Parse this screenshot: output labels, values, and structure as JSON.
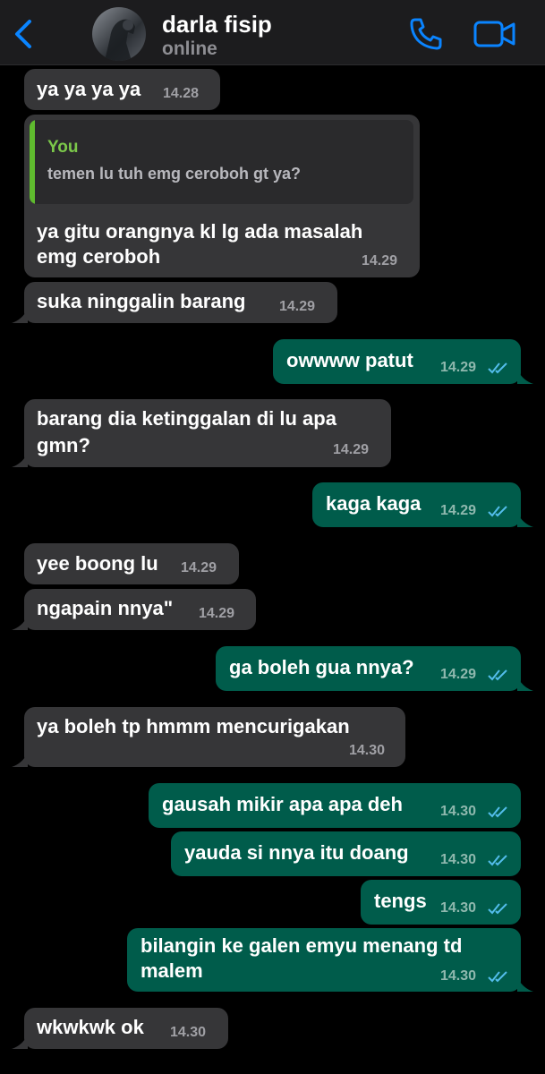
{
  "header": {
    "contact_name": "darla fisip",
    "status": "online",
    "icons": [
      "back-chevron-icon",
      "avatar",
      "phone-icon",
      "video-camera-icon"
    ],
    "accent_color": "#0a84ff"
  },
  "colors": {
    "incoming_bubble": "#363638",
    "outgoing_bubble": "#005c4b",
    "read_ticks": "#53bdeb",
    "quote_bar": "#5fbb2e"
  },
  "messages": [
    {
      "dir": "in",
      "text": "ya ya ya ya",
      "time": "14.28"
    },
    {
      "dir": "in",
      "quote_author": "You",
      "quote_text": "temen lu tuh emg ceroboh gt ya?",
      "line1": "ya gitu orangnya kl lg ada masalah",
      "line2": "emg ceroboh",
      "time": "14.29"
    },
    {
      "dir": "in",
      "text": "suka ninggalin barang",
      "time": "14.29"
    },
    {
      "dir": "out",
      "text": "owwww patut",
      "time": "14.29"
    },
    {
      "dir": "in",
      "line1": "barang dia ketinggalan di lu apa",
      "line2": "gmn?",
      "time": "14.29"
    },
    {
      "dir": "out",
      "text": "kaga kaga",
      "time": "14.29"
    },
    {
      "dir": "in",
      "text": "yee boong lu",
      "time": "14.29"
    },
    {
      "dir": "in",
      "text": "ngapain nnya\"",
      "time": "14.29"
    },
    {
      "dir": "out",
      "text": "ga boleh gua nnya?",
      "time": "14.29"
    },
    {
      "dir": "in",
      "text": "ya boleh tp hmmm mencurigakan",
      "time": "14.30"
    },
    {
      "dir": "out",
      "text": "gausah mikir apa apa deh",
      "time": "14.30"
    },
    {
      "dir": "out",
      "text": "yauda si nnya itu doang",
      "time": "14.30"
    },
    {
      "dir": "out",
      "text": "tengs",
      "time": "14.30"
    },
    {
      "dir": "out",
      "line1": "bilangin ke galen emyu menang td",
      "line2": "malem",
      "time": "14.30"
    },
    {
      "dir": "in",
      "text": "wkwkwk ok",
      "time": "14.30"
    }
  ]
}
